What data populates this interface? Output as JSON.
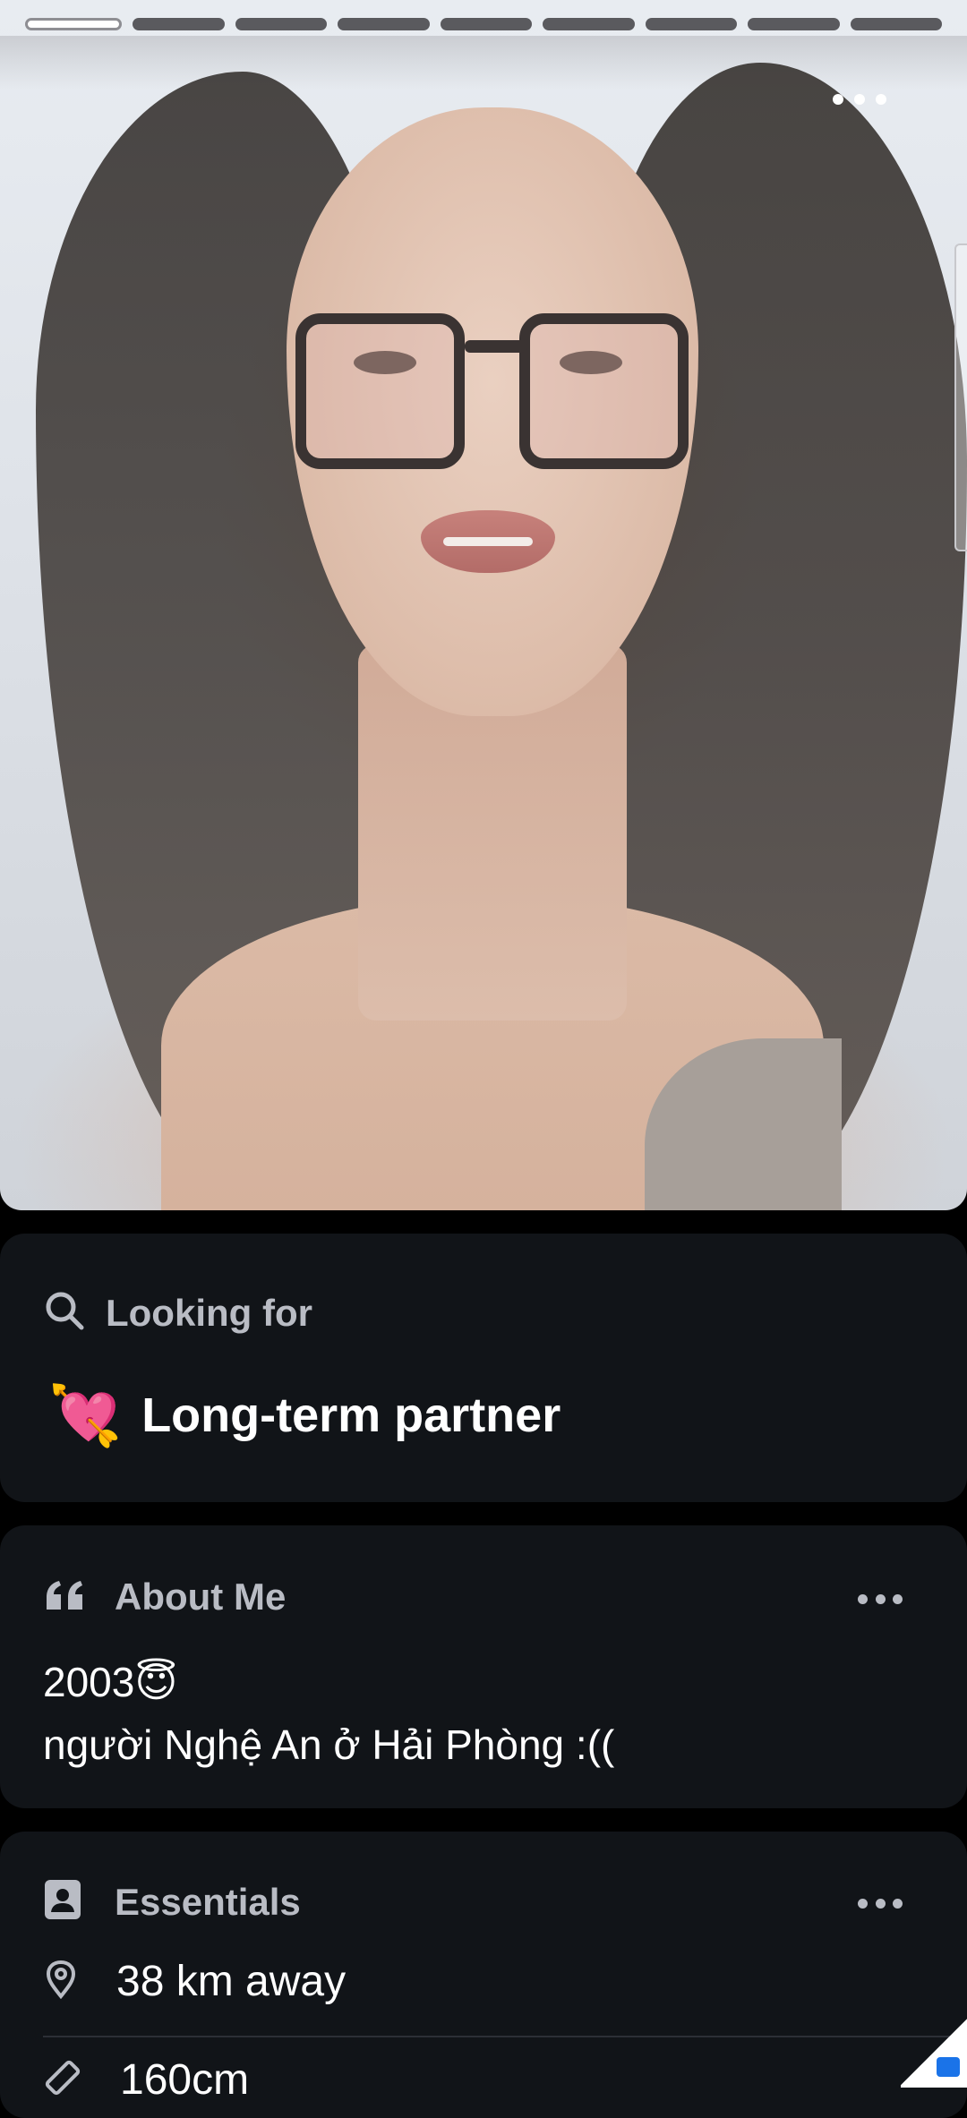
{
  "profile": {
    "photo_count": 9,
    "active_photo_index": 0,
    "photo_menu_icon": "more-horizontal-icon"
  },
  "looking_for": {
    "title": "Looking for",
    "icon": "search-icon",
    "emoji": "💘",
    "value": "Long-term partner"
  },
  "about_me": {
    "title": "About Me",
    "icon": "quote-icon",
    "line1": "2003😇",
    "line2": "người Nghệ An ở Hải Phòng :(("
  },
  "essentials": {
    "title": "Essentials",
    "icon": "id-badge-icon",
    "distance": "38 km away",
    "height": "160cm"
  },
  "colors": {
    "background": "#000000",
    "card": "#111418",
    "muted_text": "#b9bcc4",
    "text": "#ffffff"
  }
}
